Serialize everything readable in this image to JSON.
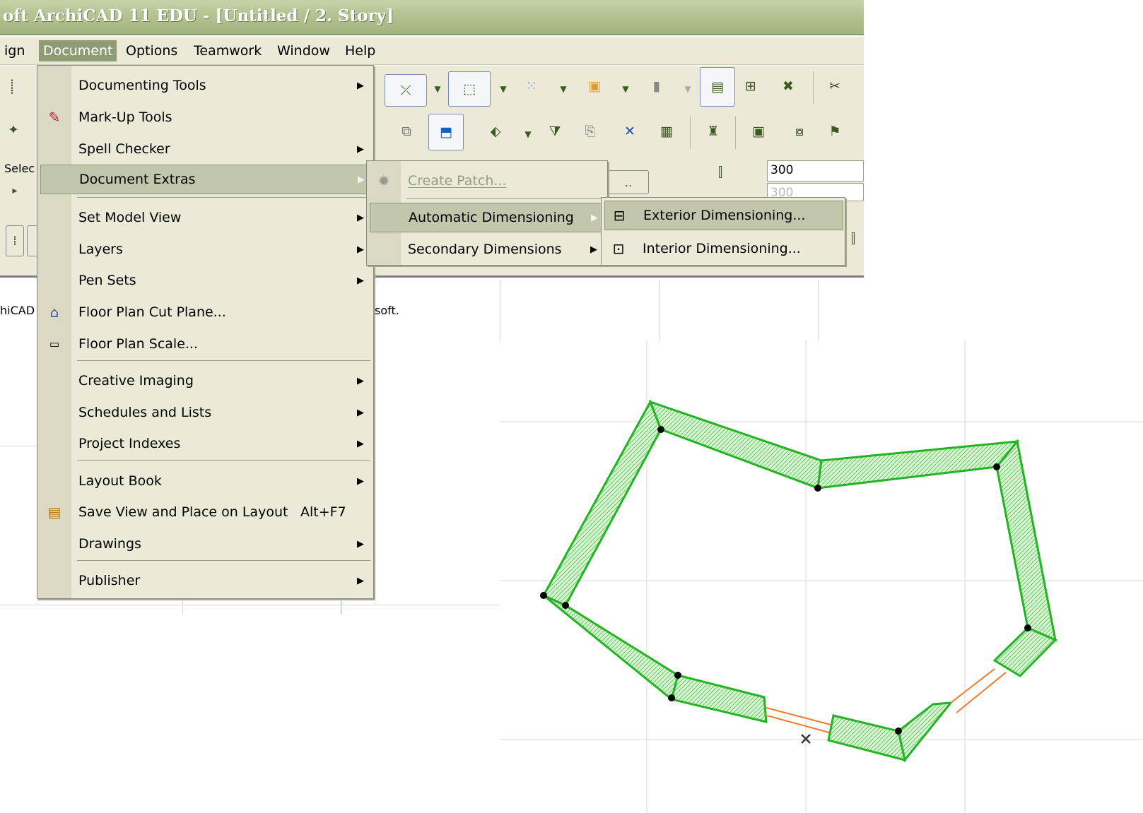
{
  "window": {
    "title": "oft ArchiCAD 11 EDU - [Untitled / 2. Story]"
  },
  "menubar": {
    "items": [
      {
        "label": "ign"
      },
      {
        "label": "Document",
        "active": true
      },
      {
        "label": "Options"
      },
      {
        "label": "Teamwork"
      },
      {
        "label": "Window"
      },
      {
        "label": "Help"
      }
    ]
  },
  "toolbar": {
    "fragments": [
      "Selec"
    ],
    "height_value": "300",
    "height_value_2": "300"
  },
  "document_menu": {
    "items": [
      {
        "label": "Documenting Tools",
        "submenu": true
      },
      {
        "label": "Mark-Up Tools",
        "icon": "pen-icon"
      },
      {
        "label": "Spell Checker",
        "submenu": true
      },
      {
        "label": "Document Extras",
        "submenu": true,
        "highlighted": true
      },
      {
        "label": "Set Model View",
        "submenu": true
      },
      {
        "label": "Layers",
        "submenu": true
      },
      {
        "label": "Pen Sets",
        "submenu": true
      },
      {
        "label": "Floor Plan Cut Plane...",
        "icon": "cut-plane-icon"
      },
      {
        "label": "Floor Plan Scale...",
        "icon": "scale-icon"
      },
      {
        "label": "Creative Imaging",
        "submenu": true
      },
      {
        "label": "Schedules and Lists",
        "submenu": true
      },
      {
        "label": "Project Indexes",
        "submenu": true
      },
      {
        "label": "Layout Book",
        "submenu": true
      },
      {
        "label": "Save View and Place on Layout",
        "shortcut": "Alt+F7",
        "icon": "save-view-icon"
      },
      {
        "label": "Drawings",
        "submenu": true
      },
      {
        "label": "Publisher",
        "submenu": true
      }
    ]
  },
  "extras_menu": {
    "items": [
      {
        "label": "Create Patch...",
        "disabled": true,
        "icon": "patch-icon"
      },
      {
        "label": "Automatic Dimensioning",
        "submenu": true,
        "highlighted": true
      },
      {
        "label": "Secondary Dimensions",
        "submenu": true
      }
    ]
  },
  "autodim_menu": {
    "items": [
      {
        "label": "Exterior Dimensioning...",
        "icon": "exterior-dimension-icon",
        "highlighted": true
      },
      {
        "label": "Interior Dimensioning...",
        "icon": "interior-dimension-icon"
      }
    ]
  },
  "background_text": {
    "left": "hiCAD",
    "right": "soft."
  },
  "plan": {
    "wall_color": "#22b422",
    "wall_fill": "#c9efc4",
    "window_color": "#f07a2a",
    "node_color": "#000000"
  }
}
